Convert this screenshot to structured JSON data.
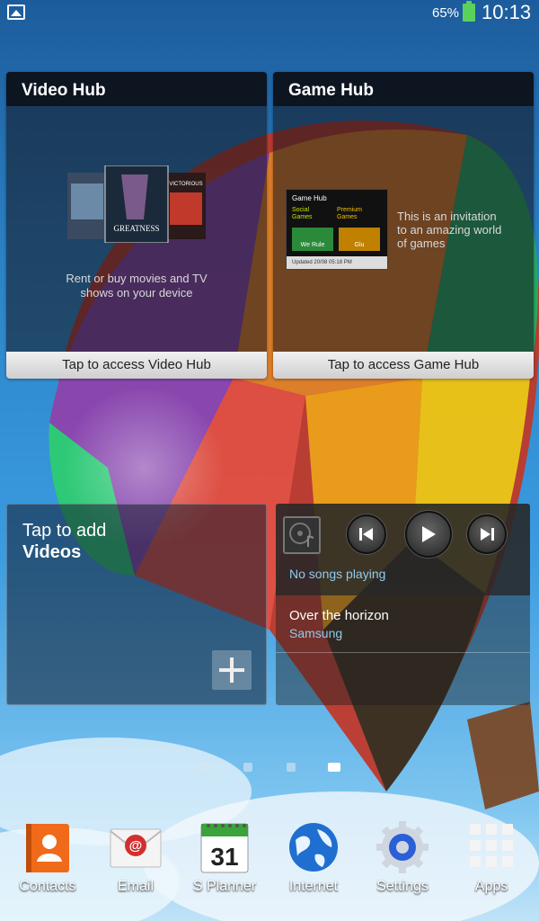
{
  "status_bar": {
    "battery_percent": "65%",
    "time": "10:13",
    "notification_icon": "gallery-icon"
  },
  "video_hub": {
    "title": "Video Hub",
    "poster_labels": [
      "GREATNESS",
      "VICTORIOUS"
    ],
    "description_line1": "Rent or buy movies and TV",
    "description_line2": "shows on your device",
    "action_label": "Tap to access Video Hub"
  },
  "game_hub": {
    "title": "Game Hub",
    "thumb": {
      "header": "Game Hub",
      "col1_line1": "Social",
      "col1_line2": "Games",
      "col2_line1": "Premium",
      "col2_line2": "Games",
      "tile1_label": "We Rule",
      "tile2_label": "Glu",
      "updated": "Updated 20/08 05:18 PM"
    },
    "description_line1": "This is an invitation",
    "description_line2": "to an amazing world",
    "description_line3": "of games",
    "action_label": "Tap to access Game Hub"
  },
  "videos_widget": {
    "line1": "Tap to add",
    "line2": "Videos"
  },
  "music_widget": {
    "status": "No songs playing",
    "song_title": "Over the horizon",
    "artist": "Samsung"
  },
  "page_indicator": {
    "count": 4,
    "active_index": 3
  },
  "dock": [
    {
      "label": "Contacts",
      "icon": "contacts-icon"
    },
    {
      "label": "Email",
      "icon": "email-icon"
    },
    {
      "label": "S Planner",
      "icon": "calendar-icon",
      "badge": "31"
    },
    {
      "label": "Internet",
      "icon": "globe-icon"
    },
    {
      "label": "Settings",
      "icon": "gear-icon"
    },
    {
      "label": "Apps",
      "icon": "apps-grid-icon"
    }
  ],
  "colors": {
    "accent_blue": "#8fcbf0",
    "battery_green": "#5ad15a"
  }
}
